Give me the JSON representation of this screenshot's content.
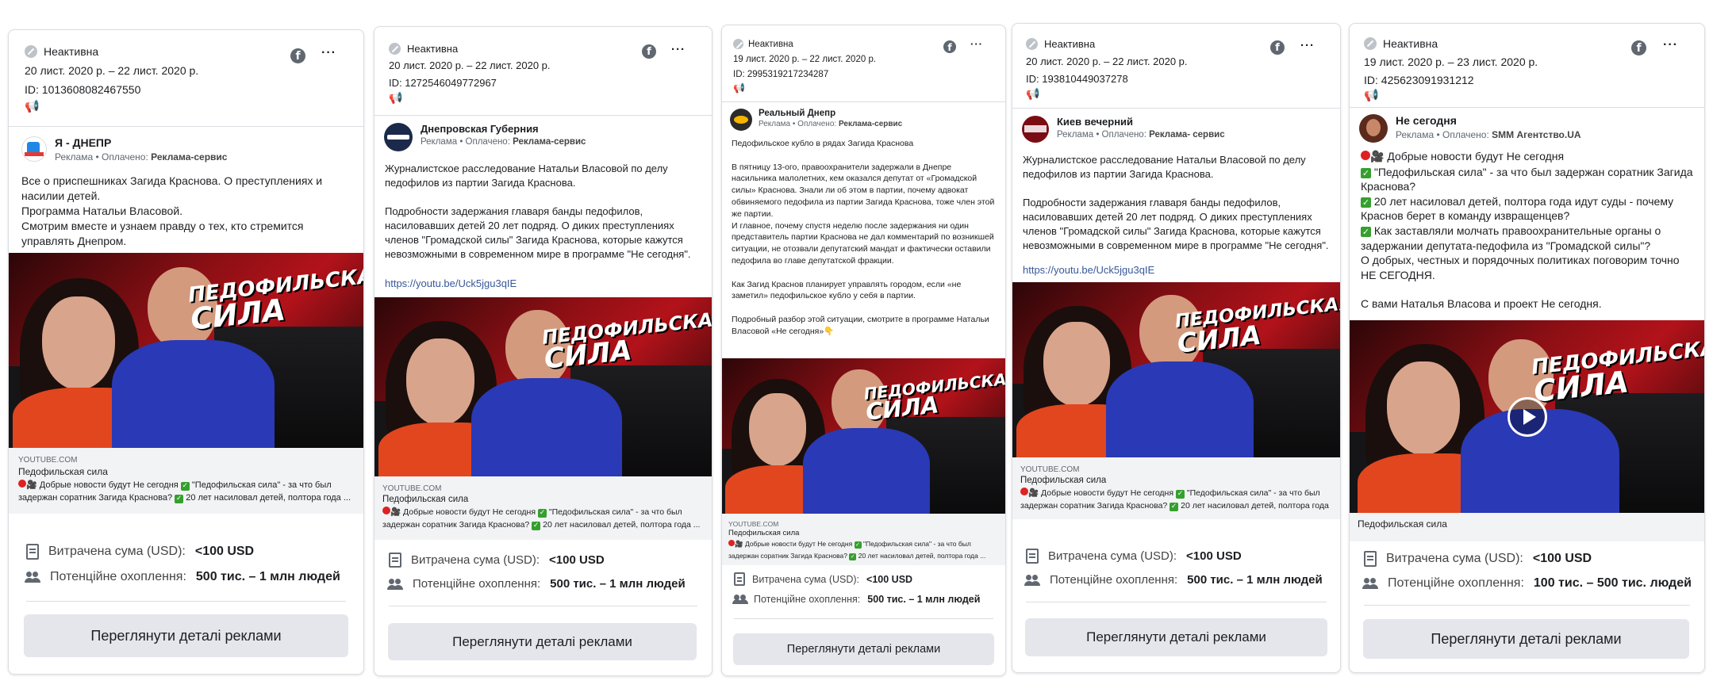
{
  "common": {
    "status": "Неактивна",
    "spend_label": "Витрачена сума (USD):",
    "spend_value": "<100 USD",
    "reach_label": "Потенційне охоплення:",
    "details_button": "Переглянути деталі реклами",
    "sponsored": "Реклама • Оплачено:",
    "link_domain": "YOUTUBE.COM",
    "link_title": "Педофильская сила",
    "link_desc_1": "Добрые новости будут Не сегодня",
    "link_desc_2": "\"Педофильская сила\" - за что был",
    "link_desc_3": "задержан соратник Загида Краснова?",
    "link_desc_4": "20 лет насиловал детей, полтора года ...",
    "image_line1": "ПЕДОФИЛЬСКАЯ",
    "image_line2": "СИЛА",
    "colors": {
      "button_bg": "#e4e6eb",
      "link": "#385898",
      "check_green": "#35a02d",
      "image_red": "#b3121a"
    }
  },
  "cards": [
    {
      "dates": "20 лист. 2020 р. – 22 лист. 2020 р.",
      "id": "ID: 1013608082467550",
      "advertiser": "Я - ДНЕПР",
      "paid_by": "Реклама-сервис",
      "body": "Все о приспешниках Загида Краснова. О преступлениях и насилии детей.\nПрограмма Натальи Власовой.\nСмотрим вместе и узнаем правду о тех, кто стремится управлять Днепром.",
      "reach": "500 тис. – 1 млн людей"
    },
    {
      "dates": "20 лист. 2020 р. – 22 лист. 2020 р.",
      "id": "ID: 1272546049772967",
      "advertiser": "Днепровская Губерния",
      "paid_by": "Реклама-сервис",
      "body": "Журналистское расследование Натальи Власовой по делу педофилов из партии Загида Краснова.\n\nПодробности задержания главаря банды педофилов, насиловавших детей 20 лет подряд. О диких преступлениях членов \"Громадской силы\" Загида Краснова, которые кажутся невозможными в современном мире в программе \"Не сегодня\".",
      "url": "https://youtu.be/Uck5jgu3qIE",
      "reach": "500 тис. – 1 млн людей"
    },
    {
      "dates": "19 лист. 2020 р. – 22 лист. 2020 р.",
      "id": "ID: 2995319217234287",
      "advertiser": "Реальный Днепр",
      "paid_by": "Реклама-сервис",
      "body": "Педофильское кубло в рядах Загида Краснова\n\nВ пятницу 13-ого, правоохранители задержали в Днепре насильника малолетних, кем оказался депутат от «Громадской силы» Краснова. Знали ли об этом в партии, почему адвокат обвиняемого педофила из партии Загида Краснова, тоже член этой же партии.\nИ главное, почему спустя неделю после задержания ни один представитель партии Краснова не дал комментарий по возникшей ситуации, не отозвали депутатский мандат и фактически оставили педофила во главе депутатской фракции.\n\nКак Загид Краснов планирует управлять городом, если «не заметил» педофильское кубло у себя в партии.\n\nПодробный разбор этой ситуации, смотрите в программе Натальи Власовой «Не сегодня»👇",
      "reach": "500 тис. – 1 млн людей"
    },
    {
      "dates": "20 лист. 2020 р. – 22 лист. 2020 р.",
      "id": "ID: 193810449037278",
      "advertiser": "Киев вечерний",
      "paid_by": "Реклама- сервис",
      "body": "Журналистское расследование Натальи Власовой по делу педофилов из партии Загида Краснова.\n\nПодробности задержания главаря банды педофилов, насиловавших детей 20 лет подряд. О диких преступлениях членов \"Громадской силы\" Загида Краснова, которые кажутся невозможными в современном мире в программе \"Не сегодня\".",
      "url": "https://youtu.be/Uck5jgu3qIE",
      "reach": "500 тис. – 1 млн людей"
    },
    {
      "dates": "19 лист. 2020 р. – 23 лист. 2020 р.",
      "id": "ID: 425623091931212",
      "advertiser": "Не сегодня",
      "paid_by": "SMM Агентство.UA",
      "body_l1": "Добрые новости будут Не сегодня",
      "body_l2": "\"Педофильская сила\" - за что был задержан соратник Загида Краснова?",
      "body_l3": "20 лет насиловал детей, полтора года идут суды - почему Краснов берет в команду извращенцев?",
      "body_l4": "Как заставляли молчать правоохранительные органы о задержании депутата-педофила из \"Громадской силы\"?",
      "body_l5": "О добрых, честных и порядочных политиках поговорим точно НЕ СЕГОДНЯ.",
      "body_l6": "С вами Наталья Власова и проект Не сегодня.",
      "video_title": "Педофильская сила",
      "reach": "100 тис. – 500 тис. людей"
    }
  ]
}
